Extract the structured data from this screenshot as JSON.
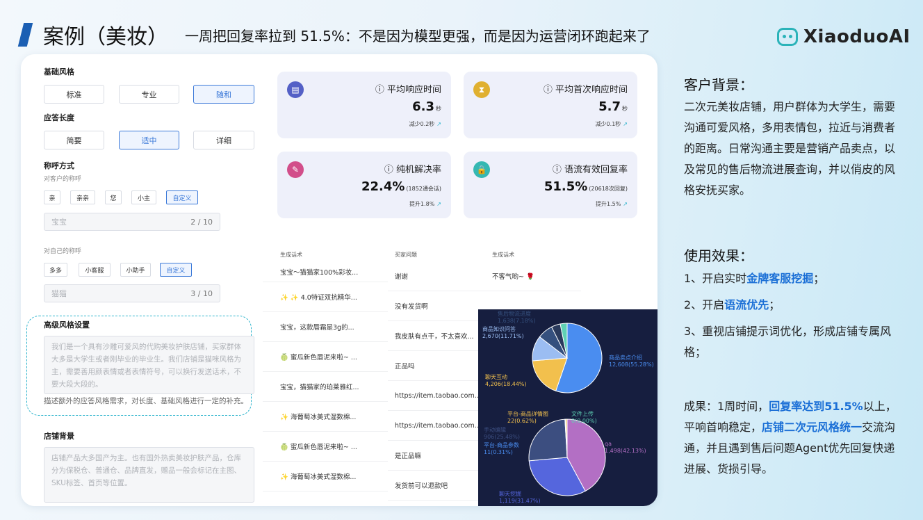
{
  "header": {
    "title": "案例（美妆）",
    "subtitle": "一周把回复率拉到 51.5%：不是因为模型更强，而是因为运营闭环跑起来了",
    "brand": "XiaoduoAI"
  },
  "settings": {
    "style_label": "基础风格",
    "style_options": [
      "标准",
      "专业",
      "随和"
    ],
    "length_label": "应答长度",
    "length_options": [
      "简要",
      "适中",
      "详细"
    ],
    "address_label": "称呼方式",
    "customer_address_label": "对客户的称呼",
    "customer_tags": [
      "亲",
      "亲亲",
      "您",
      "小主",
      "自定义"
    ],
    "customer_input_value": "宝宝",
    "customer_input_count": "2 / 10",
    "self_address_label": "对自己的称呼",
    "self_tags": [
      "多多",
      "小客服",
      "小助手",
      "自定义"
    ],
    "self_input_value": "猫猫",
    "self_input_count": "3 / 10",
    "advanced_label": "高级风格设置",
    "advanced_text": "我们是一个具有沙雕可爱风的代购美妆护肤店铺，买家群体大多是大学生或者刚毕业的毕业生。我们店铺是猫咪风格为主，需要善用颜表情或者表情符号，可以换行发送话术，不要大段大段的。",
    "advanced_desc": "描述额外的应答风格需求，对长度、基础风格进行一定的补充。",
    "shop_label": "店铺背景",
    "shop_text": "店铺产品大多国产为主。也有国外热卖美妆护肤产品，仓库分为保税仓、普通仓、品牌直发，赠品一般会标记在主图、SKU标签、首页等位置。"
  },
  "metrics": [
    {
      "title": "平均响应时间",
      "value": "6.3",
      "unit": "秒",
      "sub": "减少0.2秒",
      "icon": "document-icon",
      "color": "#5460c6"
    },
    {
      "title": "平均首次响应时间",
      "value": "5.7",
      "unit": "秒",
      "sub": "减少0.1秒",
      "icon": "hourglass-icon",
      "color": "#e0b030"
    },
    {
      "title": "纯机解决率",
      "value": "22.4%",
      "unit": "(1852通会话)",
      "sub": "提升1.8%",
      "icon": "tool-icon",
      "color": "#d24e8a"
    },
    {
      "title": "语流有效回复率",
      "value": "51.5%",
      "unit": "(20618次回复)",
      "sub": "提升1.5%",
      "icon": "lock-icon",
      "color": "#35b8b2"
    }
  ],
  "replies_table": {
    "header": "生成话术",
    "rows": [
      "宝宝～猫猫家100%彩妆...",
      "✨ ✨ 4.0特证双抗精华...",
      "宝宝，这款唇霜是3g的...",
      "🍈 蜜瓜新色唇泥来啦~ ...",
      "宝宝，猫猫家的珀莱雅红...",
      "✨ 海葡萄冰美式湿数棉...",
      "🍈 蜜瓜新色唇泥来啦~ ...",
      "✨ 海葡萄冰美式湿数棉..."
    ]
  },
  "qa_table": {
    "col1": "买家问题",
    "col2": "生成话术",
    "rows": [
      {
        "q": "谢谢",
        "a": "不客气哟~ 🌹"
      },
      {
        "q": "没有发货啊",
        "a": ""
      },
      {
        "q": "我皮肤有点干，不太喜欢...",
        "a": ""
      },
      {
        "q": "正品吗",
        "a": ""
      },
      {
        "q": "https://item.taobao.com...",
        "a": ""
      },
      {
        "q": "https://item.taobao.com...",
        "a": ""
      },
      {
        "q": "是正品嘛",
        "a": ""
      },
      {
        "q": "发货前可以退款吧",
        "a": ""
      }
    ]
  },
  "chart_data": [
    {
      "type": "pie",
      "title": "",
      "slices": [
        {
          "name": "商品卖点介绍",
          "label": "12,608(55.28%)",
          "value": 55.28,
          "color": "#4a8df0"
        },
        {
          "name": "聊天互动",
          "label": "4,206(18.44%)",
          "value": 18.44,
          "color": "#f2c04d"
        },
        {
          "name": "商品知识问答",
          "label": "2,670(11.71%)",
          "value": 11.71,
          "color": "#9bbdf2"
        },
        {
          "name": "售后物流进度",
          "label": "1,638(7.18%)",
          "value": 7.18,
          "color": "#35507e"
        },
        {
          "name": "",
          "label": "",
          "value": 4.2,
          "color": "#2a3a5c"
        },
        {
          "name": "",
          "label": "",
          "value": 3.19,
          "color": "#5fd1b4"
        }
      ]
    },
    {
      "type": "pie",
      "title": "",
      "slices": [
        {
          "name": "qa",
          "label": "1,498(42.13%)",
          "value": 42.13,
          "color": "#b36fc4"
        },
        {
          "name": "聊天挖掘",
          "label": "1,119(31.47%)",
          "value": 31.47,
          "color": "#5566dd"
        },
        {
          "name": "手动编辑",
          "label": "906(25.48%)",
          "value": 25.48,
          "color": "#3c4e80"
        },
        {
          "name": "平台-商品参数",
          "label": "11(0.31%)",
          "value": 0.31,
          "color": "#4a8df0"
        },
        {
          "name": "平台-商品详情图",
          "label": "22(0.62%)",
          "value": 0.62,
          "color": "#f2c04d"
        },
        {
          "name": "文件上传",
          "label": "0(0.00%)",
          "value": 0.0,
          "color": "#5fd1b4"
        }
      ]
    }
  ],
  "right": {
    "background_title": "客户背景：",
    "background_text": "二次元美妆店铺，用户群体为大学生，需要沟通可爱风格，多用表情包，拉近与消费者的距离。日常沟通主要是营销产品卖点，以及常见的售后物流进展查询，并以俏皮的风格安抚买家。",
    "effect_title": "使用效果：",
    "e1_pre": "1、开启实时",
    "e1_bold": "金牌客服挖掘",
    "e1_post": "；",
    "e2_pre": "2、开启",
    "e2_bold": "语流优先",
    "e2_post": "；",
    "e3": "3、重视店铺提示词优化，形成店铺专属风格；",
    "r_pre": "成果：1周时间，",
    "r_bold1": "回复率达到51.5%",
    "r_mid": "以上，平响首响稳定，",
    "r_bold2": "店铺二次元风格统一",
    "r_post": "交流沟通，并且遇到售后问题Agent优先回复快递进展、货损引导。"
  }
}
